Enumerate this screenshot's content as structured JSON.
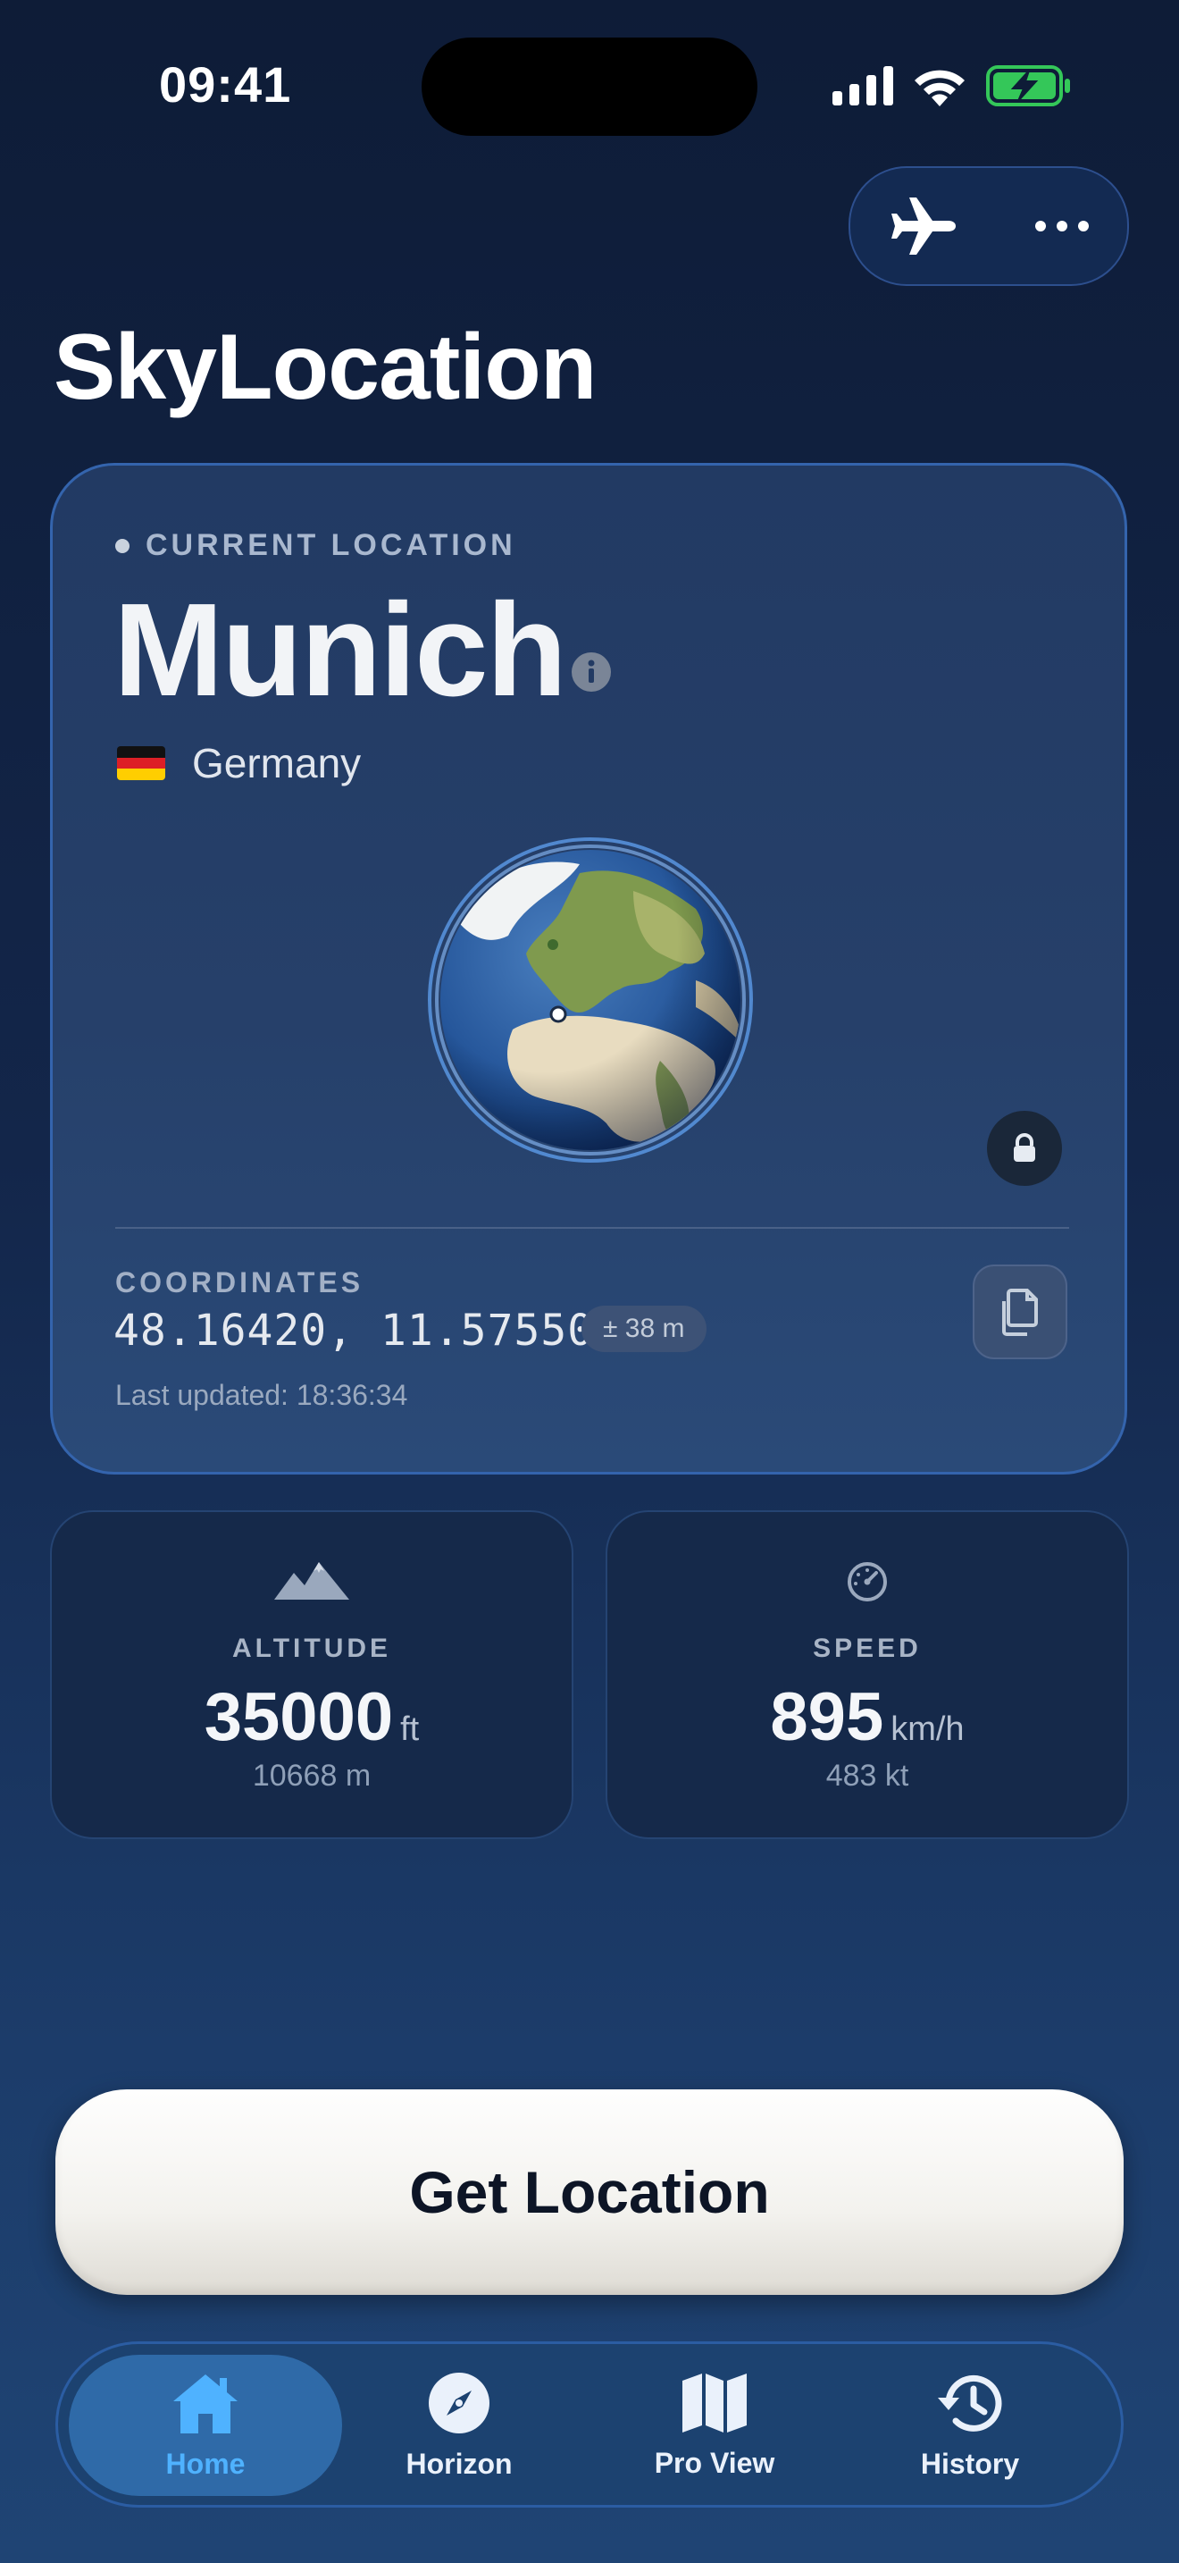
{
  "status_bar": {
    "time": "09:41"
  },
  "header": {
    "app_title": "SkyLocation",
    "airplane_icon": "airplane-icon",
    "more_icon": "ellipsis-icon"
  },
  "location_card": {
    "label": "CURRENT LOCATION",
    "city": "Munich",
    "country": "Germany",
    "coordinates_label": "COORDINATES",
    "coordinates": "48.16420, 11.57550",
    "accuracy": "± 38 m",
    "last_updated": "Last updated: 18:36:34"
  },
  "stats": {
    "altitude": {
      "label": "ALTITUDE",
      "value": "35000",
      "unit": "ft",
      "secondary": "10668 m"
    },
    "speed": {
      "label": "SPEED",
      "value": "895",
      "unit": "km/h",
      "secondary": "483 kt"
    }
  },
  "cta": {
    "label": "Get Location"
  },
  "tabs": [
    {
      "label": "Home",
      "icon": "house-icon",
      "active": true
    },
    {
      "label": "Horizon",
      "icon": "compass-icon",
      "active": false
    },
    {
      "label": "Pro View",
      "icon": "map-icon",
      "active": false
    },
    {
      "label": "History",
      "icon": "history-icon",
      "active": false
    }
  ],
  "colors": {
    "accent": "#4fb2ff",
    "card_border": "#3464ad",
    "battery": "#34c759"
  }
}
